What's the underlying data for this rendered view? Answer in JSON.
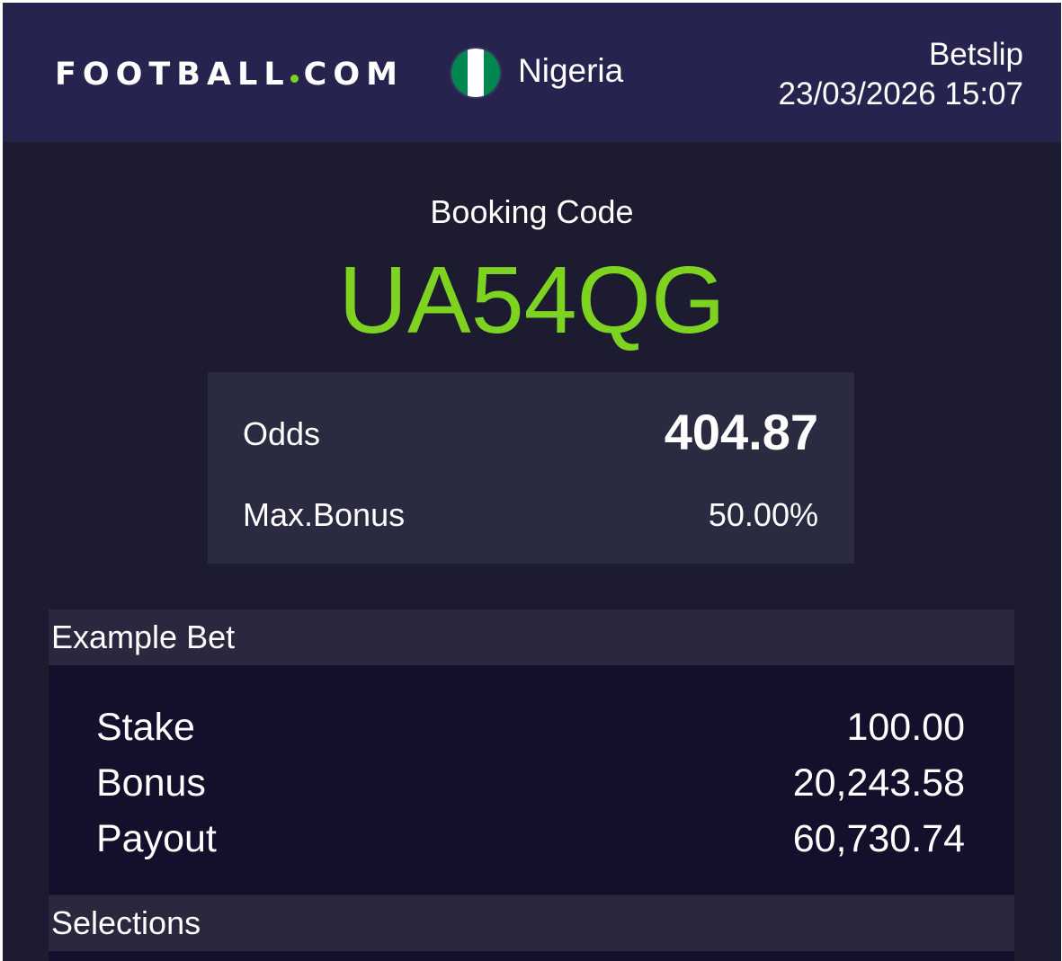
{
  "header": {
    "logo_left": "FOOTBALL",
    "logo_right": "COM",
    "country": "Nigeria",
    "flag_colors": [
      "#008751",
      "#ffffff",
      "#008751"
    ],
    "title": "Betslip",
    "datetime": "23/03/2026 15:07"
  },
  "booking": {
    "label": "Booking Code",
    "code": "UA54QG"
  },
  "summary": {
    "odds_label": "Odds",
    "odds_value": "404.87",
    "max_bonus_label": "Max.Bonus",
    "max_bonus_value": "50.00%"
  },
  "example_bet": {
    "title": "Example Bet",
    "rows": [
      {
        "label": "Stake",
        "value": "100.00"
      },
      {
        "label": "Bonus",
        "value": "20,243.58"
      },
      {
        "label": "Payout",
        "value": "60,730.74"
      }
    ]
  },
  "selections": {
    "title": "Selections"
  },
  "colors": {
    "accent": "#7ed321",
    "header_bg": "#26244f",
    "page_bg": "#1c1b30",
    "card_bg": "#2a2a40"
  }
}
